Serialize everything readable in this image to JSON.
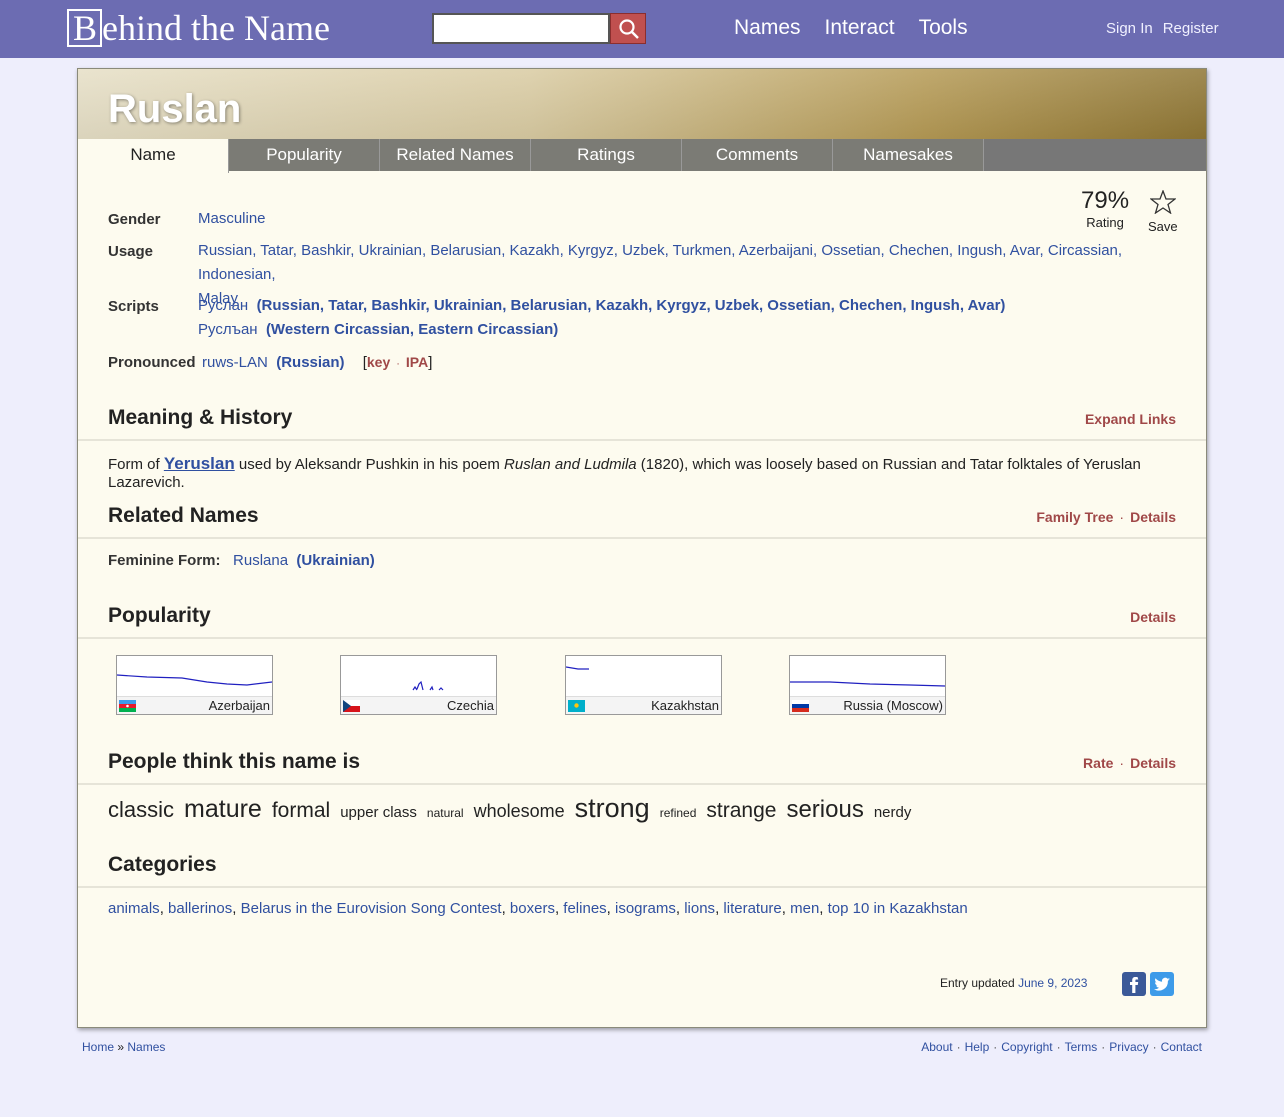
{
  "header": {
    "logo_initial": "B",
    "logo_rest": "ehind the Name",
    "search_placeholder": "",
    "nav": [
      "Names",
      "Interact",
      "Tools"
    ],
    "sign_in": "Sign In",
    "register": "Register"
  },
  "name": {
    "title": "Ruslan",
    "tabs": [
      "Name",
      "Popularity",
      "Related Names",
      "Ratings",
      "Comments",
      "Namesakes"
    ],
    "rating_pct": "79%",
    "rating_label": "Rating",
    "save_label": "Save",
    "gender_label": "Gender",
    "gender_value": "Masculine",
    "usage_label": "Usage",
    "usage_line1": "Russian, Tatar, Bashkir, Ukrainian, Belarusian, Kazakh, Kyrgyz, Uzbek, Turkmen, Azerbaijani, Ossetian, Chechen, Ingush, Avar, Circassian, Indonesian,",
    "usage_line2": "Malay",
    "scripts_label": "Scripts",
    "script1": "Руслан",
    "script1_langs": "(Russian, Tatar, Bashkir, Ukrainian, Belarusian, Kazakh, Kyrgyz, Uzbek, Ossetian, Chechen, Ingush, Avar)",
    "script2": "Руслъан",
    "script2_langs": "(Western Circassian, Eastern Circassian)",
    "pronounced_label": "Pronounced",
    "pronunciation": "ruws-LAN",
    "pronunciation_lang": "(Russian)",
    "key_label": "key",
    "ipa_label": "IPA"
  },
  "meaning": {
    "heading": "Meaning & History",
    "expand_links": "Expand Links",
    "text_before": "Form of ",
    "link": "Yeruslan",
    "text_mid": " used by Aleksandr Pushkin in his poem ",
    "title_italic": "Ruslan and Ludmila",
    "text_after": " (1820), which was loosely based on Russian and Tatar folktales of Yeruslan Lazarevich."
  },
  "related": {
    "heading": "Related Names",
    "family_tree": "Family Tree",
    "details": "Details",
    "feminine_label": "Feminine Form:",
    "feminine_name": "Ruslana",
    "feminine_lang": "(Ukrainian)"
  },
  "popularity": {
    "heading": "Popularity",
    "details": "Details",
    "countries": [
      "Azerbaijan",
      "Czechia",
      "Kazakhstan",
      "Russia (Moscow)"
    ]
  },
  "people_think": {
    "heading": "People think this name is",
    "rate": "Rate",
    "details": "Details",
    "words": [
      {
        "w": "classic",
        "size": 22
      },
      {
        "w": "mature",
        "size": 25
      },
      {
        "w": "formal",
        "size": 21
      },
      {
        "w": "upper class",
        "size": 15
      },
      {
        "w": "natural",
        "size": 12
      },
      {
        "w": "wholesome",
        "size": 18
      },
      {
        "w": "strong",
        "size": 27
      },
      {
        "w": "refined",
        "size": 12
      },
      {
        "w": "strange",
        "size": 21
      },
      {
        "w": "serious",
        "size": 24
      },
      {
        "w": "nerdy",
        "size": 15
      }
    ]
  },
  "categories": {
    "heading": "Categories",
    "items": [
      "animals",
      "ballerinos",
      "Belarus in the Eurovision Song Contest",
      "boxers",
      "felines",
      "isograms",
      "lions",
      "literature",
      "men",
      "top 10 in Kazakhstan"
    ]
  },
  "entry": {
    "updated_label": "Entry updated",
    "updated_date": "June 9, 2023"
  },
  "footer": {
    "home": "Home",
    "sep": "»",
    "names": "Names",
    "links": [
      "About",
      "Help",
      "Copyright",
      "Terms",
      "Privacy",
      "Contact"
    ]
  },
  "colors": {
    "topbar": "#6c6cb2",
    "link": "#3050a0",
    "accent_link": "#a04848",
    "panel_bg": "#fdfbef"
  }
}
